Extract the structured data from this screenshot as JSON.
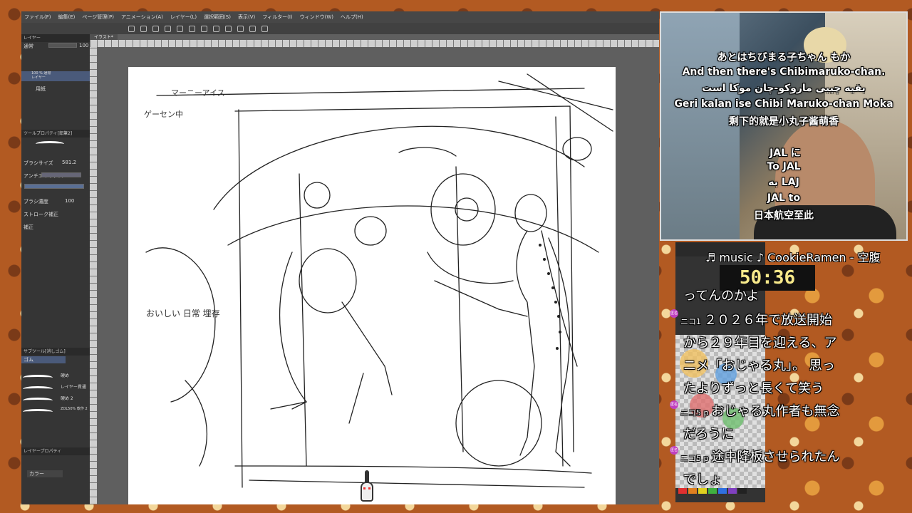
{
  "app": {
    "menu": [
      "ファイル(F)",
      "編集(E)",
      "ページ管理(P)",
      "アニメーション(A)",
      "レイヤー(L)",
      "選択範囲(S)",
      "表示(V)",
      "フィルター(I)",
      "ウィンドウ(W)",
      "ヘルプ(H)"
    ],
    "doc_tab": "イラスト*",
    "left_panel": {
      "layer_title": "レイヤー",
      "blend_mode": "通常",
      "opacity": "100",
      "layer1": "100 % 通常\nレイヤー",
      "layer2": "用紙",
      "tool_property": "ツールプロパティ[鉛筆2]",
      "size_label": "ブラシサイズ",
      "size_value": "581.2",
      "aa_label": "アンチエイリアス",
      "density_label": "ブラシ濃度",
      "density_value": "100",
      "stabilizer_label": "ストローク補正",
      "correction_label": "補正",
      "subtool_title": "サブツール[消しゴム]",
      "eraser_label": "ゴム",
      "eraser_items": [
        "硬め",
        "レイヤー貫通",
        "硬め 2",
        "ZOL50% 軟作 2"
      ],
      "layer_property": "レイヤープロパティ",
      "color_label": "カラー"
    },
    "sketch_notes": [
      "マーニーアイス",
      "ゲーセン中",
      "おいしい 日常 埋存"
    ]
  },
  "webcam": {
    "subtitles_top": [
      "あとはちびまる子ちゃん もか",
      "And then there's Chibimaruko-chan.",
      "بقیه چیبی ماروکو-چان موکا است",
      "Geri kalan ise Chibi Maruko-chan Moka",
      "剩下的就是小丸子酱萌香"
    ],
    "subtitles_bottom": [
      "JAL に",
      "To JAL",
      "به LAJ",
      "JAL to",
      "日本航空至此"
    ]
  },
  "music": "♬ music ♪ CookieRamen - 空腹",
  "timer": "50:36",
  "comments": [
    {
      "tag": "",
      "text": "ってんのかよ"
    },
    {
      "tag": "ニコ1",
      "text": "２０２６年で放送開始"
    },
    {
      "tag": "",
      "text": "から２９年目を迎える、ア"
    },
    {
      "tag": "",
      "text": "ニメ「おじゃる丸」。 思っ"
    },
    {
      "tag": "",
      "text": "たよりずっと長くて笑う"
    },
    {
      "tag": "ニコ5 p",
      "text": "おじゃる丸作者も無念"
    },
    {
      "tag": "",
      "text": "だろうに"
    },
    {
      "tag": "ニコ5 p",
      "text": "途中降板させられたん"
    },
    {
      "tag": "",
      "text": "でしょ"
    }
  ],
  "badges": [
    "匿名",
    "匿名",
    "匿名"
  ],
  "colors": {
    "accent_timer": "#f7e98a",
    "palette": [
      "#e03030",
      "#e08020",
      "#e0d020",
      "#40b040",
      "#3070e0",
      "#8040c0",
      "#222222"
    ]
  }
}
